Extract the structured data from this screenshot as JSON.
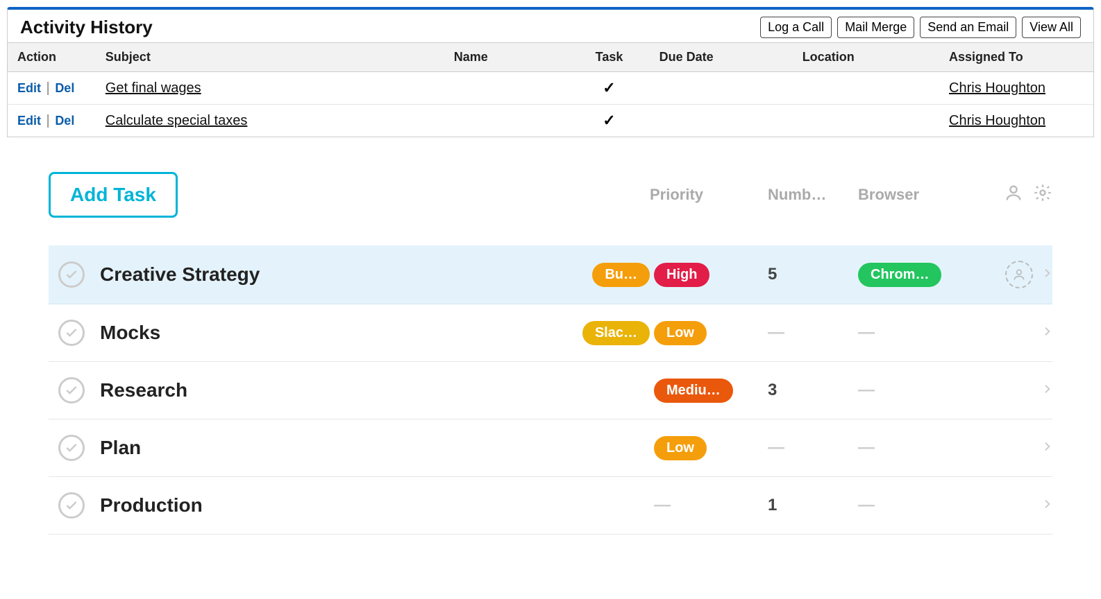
{
  "activity_history": {
    "title": "Activity History",
    "buttons": {
      "log_call": "Log a Call",
      "mail_merge": "Mail Merge",
      "send_email": "Send an Email",
      "view_all": "View All"
    },
    "columns": {
      "action": "Action",
      "subject": "Subject",
      "name": "Name",
      "task": "Task",
      "due_date": "Due Date",
      "location": "Location",
      "assigned_to": "Assigned To"
    },
    "action_labels": {
      "edit": "Edit",
      "del": "Del"
    },
    "check_glyph": "✓",
    "rows": [
      {
        "subject": "Get final wages",
        "name": "",
        "task": true,
        "due_date": "",
        "location": "",
        "assigned_to": "Chris Houghton"
      },
      {
        "subject": "Calculate special taxes",
        "name": "",
        "task": true,
        "due_date": "",
        "location": "",
        "assigned_to": "Chris Houghton"
      }
    ]
  },
  "task_list": {
    "add_label": "Add Task",
    "columns": {
      "priority": "Priority",
      "number": "Numb…",
      "browser": "Browser"
    },
    "dash": "—",
    "rows": [
      {
        "title": "Creative Strategy",
        "highlight": true,
        "tag": {
          "label": "Bu…",
          "color": "#f59e0b"
        },
        "priority": {
          "label": "High",
          "color": "#e11d48"
        },
        "number": "5",
        "browser": {
          "label": "Chrom…",
          "color": "#22c55e"
        },
        "has_assignee_placeholder": true
      },
      {
        "title": "Mocks",
        "highlight": false,
        "tag": {
          "label": "Slac…",
          "color": "#eab308"
        },
        "priority": {
          "label": "Low",
          "color": "#f59e0b"
        },
        "number": null,
        "browser": null,
        "has_assignee_placeholder": false
      },
      {
        "title": "Research",
        "highlight": false,
        "tag": null,
        "priority": {
          "label": "Mediu…",
          "color": "#ea580c"
        },
        "number": "3",
        "browser": null,
        "has_assignee_placeholder": false
      },
      {
        "title": "Plan",
        "highlight": false,
        "tag": null,
        "priority": {
          "label": "Low",
          "color": "#f59e0b"
        },
        "number": null,
        "browser": null,
        "has_assignee_placeholder": false
      },
      {
        "title": "Production",
        "highlight": false,
        "tag": null,
        "priority": null,
        "number": "1",
        "browser": null,
        "has_assignee_placeholder": false
      }
    ]
  }
}
